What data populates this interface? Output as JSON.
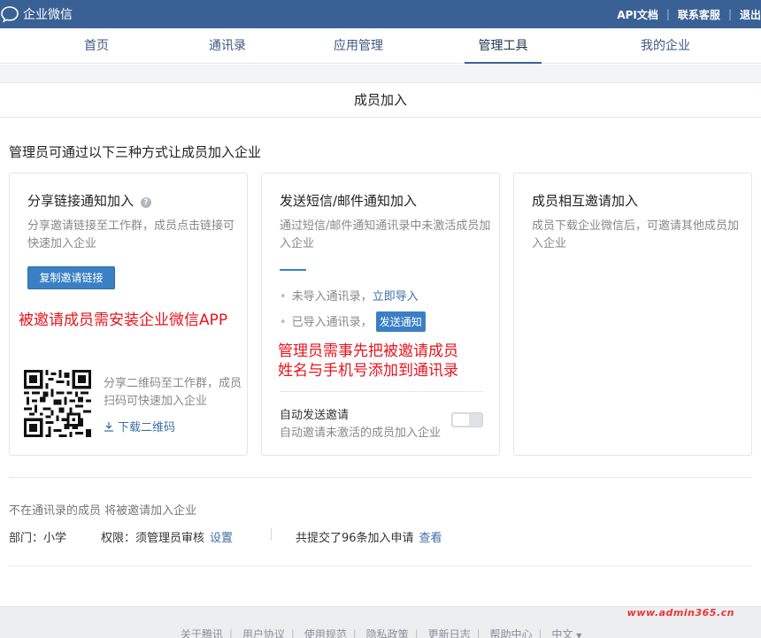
{
  "header": {
    "logo_text": "企业微信",
    "links": [
      "API文档",
      "联系客服",
      "退出"
    ]
  },
  "nav": {
    "items": [
      "首页",
      "通讯录",
      "应用管理",
      "管理工具",
      "我的企业"
    ],
    "active": "管理工具"
  },
  "page_title": "成员加入",
  "intro": "管理员可通过以下三种方式让成员加入企业",
  "card_share": {
    "title": "分享链接通知加入",
    "help_icon": "?",
    "desc": "分享邀请链接至工作群，成员点击链接可快速加入企业",
    "copy_button": "复制邀请链接",
    "note": "被邀请成员需安装企业微信APP",
    "qr_desc": "分享二维码至工作群，成员扫码可快速加入企业",
    "qr_download": "下载二维码"
  },
  "card_sms": {
    "title": "发送短信/邮件通知加入",
    "desc": "通过短信/邮件通知通讯录中未激活成员加入企业",
    "item1_text": "未导入通讯录，",
    "item1_link": "立即导入",
    "item2_text": "已导入通讯录，",
    "item2_button": "发送通知",
    "note_line1": "管理员需事先把被邀请成员",
    "note_line2": "姓名与手机号添加到通讯录",
    "auto_title": "自动发送邀请",
    "auto_desc": "自动邀请未激活的成员加入企业",
    "auto_enabled": false
  },
  "card_mutual": {
    "title": "成员相互邀请加入",
    "desc": "成员下载企业微信后，可邀请其他成员加入企业"
  },
  "pending": {
    "text": "不在通讯录的成员 将被邀请加入企业",
    "department": "部门：小学",
    "permission": "权限：须管理员审核",
    "settings_link": "设置",
    "requests": "共提交了96条加入申请",
    "view_link": "查看"
  },
  "footer": {
    "links": [
      "关于腾讯",
      "用户协议",
      "使用规范",
      "隐私政策",
      "更新日志",
      "帮助中心",
      "中文"
    ],
    "language_caret": "▼",
    "watermark": "www.admin365.cn"
  },
  "colors": {
    "topbar": "#3a6196",
    "accent": "#3b80c4",
    "link": "#3d6fa6",
    "note_red": "#e8141c"
  }
}
